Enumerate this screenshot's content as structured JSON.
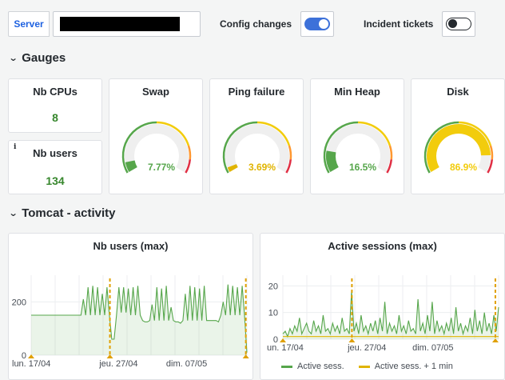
{
  "toolbar": {
    "variable_label": "Server",
    "variable_value": "",
    "config_changes_label": "Config changes",
    "config_changes_on": true,
    "incident_tickets_label": "Incident tickets",
    "incident_tickets_on": false
  },
  "rows": {
    "gauges_title": "Gauges",
    "tomcat_title": "Tomcat - activity"
  },
  "stats": {
    "nb_cpus": {
      "title": "Nb CPUs",
      "value": "8"
    },
    "nb_users": {
      "title": "Nb users",
      "value": "134",
      "info_icon": "i"
    }
  },
  "gauges": [
    {
      "title": "Swap",
      "value": 7.77,
      "display": "7.77%",
      "color": "#56a64b"
    },
    {
      "title": "Ping failure",
      "value": 3.69,
      "display": "3.69%",
      "color": "#e0b400"
    },
    {
      "title": "Min Heap",
      "value": 16.5,
      "display": "16.5%",
      "color": "#56a64b"
    },
    {
      "title": "Disk",
      "value": 86.9,
      "display": "86.9%",
      "color": "#f2cc0c"
    }
  ],
  "colors": {
    "green": "#56a64b",
    "yellow": "#f2cc0c",
    "red": "#e02f44",
    "orange": "#ff9830",
    "annotation": "#e0a000",
    "brand_blue": "#1f62e0"
  },
  "chart_data": [
    {
      "type": "line",
      "title": "Nb users (max)",
      "x_ticks": [
        "lun. 17/04",
        "jeu. 27/04",
        "dim. 07/05"
      ],
      "y_ticks": [
        "0",
        "200"
      ],
      "ylim": [
        0,
        300
      ],
      "series": [
        {
          "values": [
            150,
            150,
            150,
            150,
            150,
            150,
            150,
            150,
            150,
            150,
            150,
            150,
            150,
            150,
            150,
            150,
            150,
            150,
            150,
            150,
            150,
            150,
            210,
            150,
            255,
            150,
            260,
            150,
            255,
            150,
            230,
            150,
            255,
            150,
            60,
            60,
            150,
            255,
            160,
            255,
            160,
            250,
            150,
            255,
            150,
            260,
            150,
            130,
            125,
            125,
            130,
            190,
            130,
            255,
            130,
            250,
            130,
            260,
            130,
            180,
            130,
            125,
            125,
            120,
            130,
            230,
            130,
            260,
            130,
            255,
            130,
            250,
            130,
            260,
            130,
            130,
            130,
            130,
            130,
            125,
            150,
            200,
            150,
            265,
            150,
            260,
            150,
            255,
            150,
            260,
            150,
            10
          ]
        }
      ]
    },
    {
      "type": "line",
      "title": "Active sessions (max)",
      "x_ticks": [
        "un. 17/04",
        "jeu. 27/04",
        "dim. 07/05"
      ],
      "y_ticks": [
        "0",
        "10",
        "20"
      ],
      "ylim": [
        0,
        24
      ],
      "series": [
        {
          "name": "Active sess.",
          "values": [
            2,
            3,
            1,
            4,
            2,
            5,
            3,
            8,
            2,
            4,
            6,
            3,
            2,
            7,
            3,
            5,
            2,
            9,
            3,
            4,
            2,
            6,
            3,
            5,
            2,
            8,
            3,
            4,
            2,
            18,
            3,
            6,
            2,
            9,
            3,
            5,
            2,
            6,
            3,
            7,
            2,
            8,
            3,
            14,
            2,
            6,
            3,
            5,
            2,
            9,
            3,
            5,
            2,
            7,
            3,
            4,
            2,
            15,
            3,
            6,
            2,
            9,
            3,
            14,
            2,
            7,
            3,
            5,
            2,
            6,
            3,
            8,
            2,
            12,
            3,
            6,
            2,
            5,
            3,
            8,
            2,
            11,
            3,
            7,
            2,
            10,
            3,
            6,
            2,
            9,
            3,
            12
          ]
        },
        {
          "name": "Active sess. + 1 min",
          "values": [
            1,
            1,
            1,
            1,
            1,
            1,
            1,
            1,
            1,
            1,
            1,
            1,
            1,
            1,
            1,
            1,
            1,
            1,
            1,
            1,
            1,
            1,
            1,
            1,
            1,
            1,
            1,
            1,
            1,
            1,
            1,
            1,
            1,
            1,
            1,
            1,
            1,
            1,
            1,
            1,
            1,
            1,
            1,
            1,
            1,
            1,
            1,
            1,
            1,
            1,
            1,
            1,
            1,
            1,
            1,
            1,
            1,
            1,
            1,
            1,
            1,
            1,
            1,
            1,
            1,
            1,
            1,
            1,
            1,
            1,
            1,
            1,
            1,
            1,
            1,
            1,
            1,
            1,
            1,
            1,
            1,
            1,
            1,
            1,
            1,
            1,
            1,
            1,
            1,
            1,
            1,
            1
          ]
        }
      ]
    }
  ]
}
